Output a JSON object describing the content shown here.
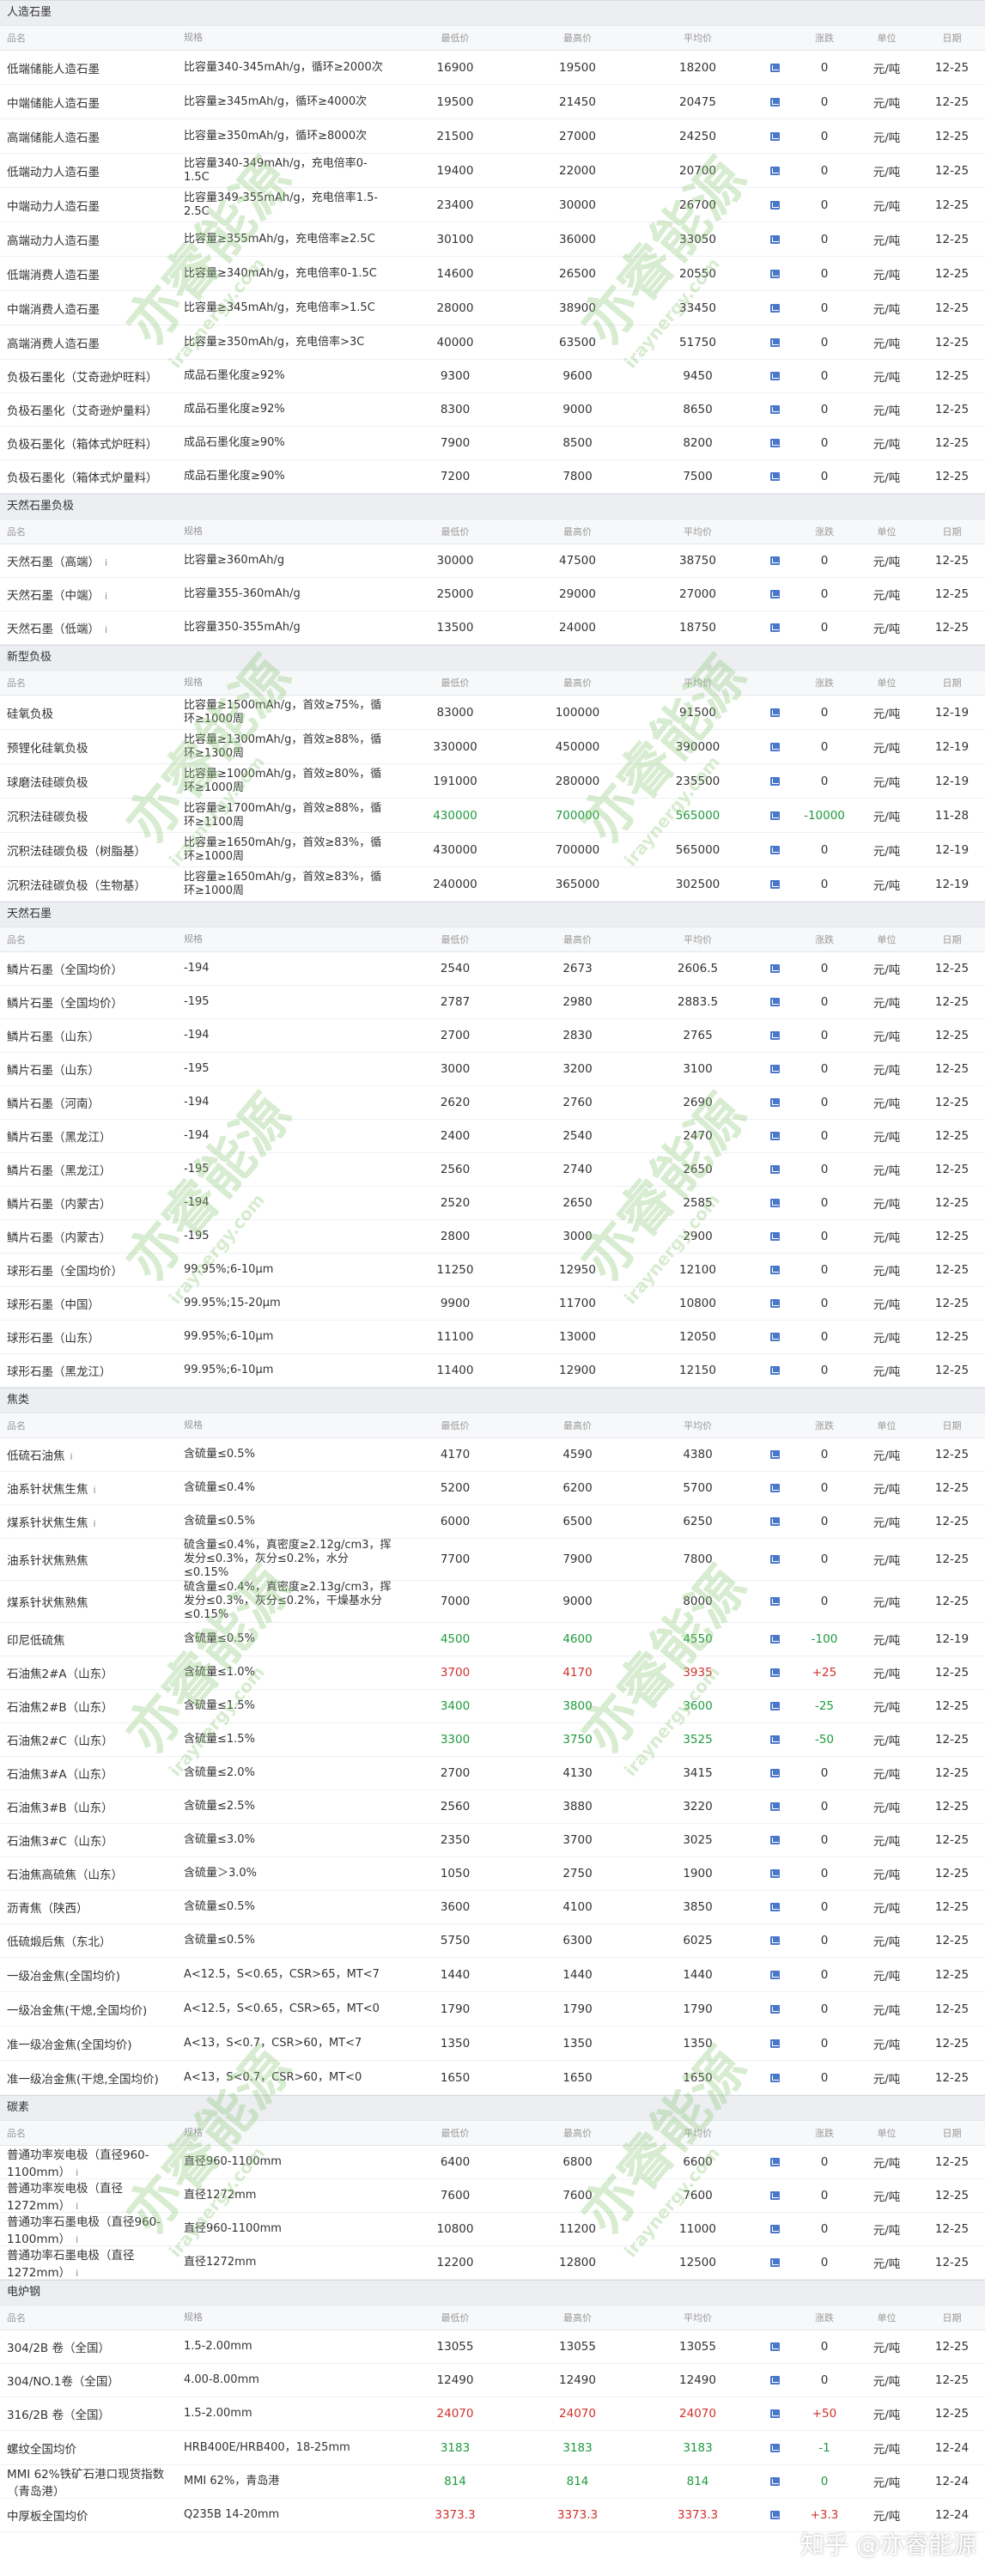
{
  "col_headers": {
    "name": "品名",
    "spec": "规格",
    "low": "最低价",
    "high": "最高价",
    "avg": "平均价",
    "chart": "",
    "change": "涨跌",
    "unit": "单位",
    "date": "日期"
  },
  "info_icon": "i",
  "colors": {
    "up": "#d0312d",
    "down": "#1e9a3e",
    "chart_icon": "#4a78c9"
  },
  "watermark": {
    "text": "亦睿能源",
    "sub": "iraynergy.com"
  },
  "zhihu_mark": "知乎 @亦睿能源",
  "sections": [
    {
      "title": "人造石墨",
      "rows": [
        {
          "name": "低端储能人造石墨",
          "spec": "比容量340-345mAh/g，循环≥2000次",
          "low": "16900",
          "high": "19500",
          "avg": "18200",
          "change": "0",
          "unit": "元/吨",
          "date": "12-25"
        },
        {
          "name": "中端储能人造石墨",
          "spec": "比容量≥345mAh/g，循环≥4000次",
          "low": "19500",
          "high": "21450",
          "avg": "20475",
          "change": "0",
          "unit": "元/吨",
          "date": "12-25"
        },
        {
          "name": "高端储能人造石墨",
          "spec": "比容量≥350mAh/g，循环≥8000次",
          "low": "21500",
          "high": "27000",
          "avg": "24250",
          "change": "0",
          "unit": "元/吨",
          "date": "12-25"
        },
        {
          "name": "低端动力人造石墨",
          "spec": "比容量340-349mAh/g，充电倍率0-1.5C",
          "low": "19400",
          "high": "22000",
          "avg": "20700",
          "change": "0",
          "unit": "元/吨",
          "date": "12-25"
        },
        {
          "name": "中端动力人造石墨",
          "spec": "比容量349-355mAh/g，充电倍率1.5-2.5C",
          "low": "23400",
          "high": "30000",
          "avg": "26700",
          "change": "0",
          "unit": "元/吨",
          "date": "12-25"
        },
        {
          "name": "高端动力人造石墨",
          "spec": "比容量≥355mAh/g，充电倍率≥2.5C",
          "low": "30100",
          "high": "36000",
          "avg": "33050",
          "change": "0",
          "unit": "元/吨",
          "date": "12-25"
        },
        {
          "name": "低端消费人造石墨",
          "spec": "比容量≥340mAh/g，充电倍率0-1.5C",
          "low": "14600",
          "high": "26500",
          "avg": "20550",
          "change": "0",
          "unit": "元/吨",
          "date": "12-25"
        },
        {
          "name": "中端消费人造石墨",
          "spec": "比容量≥345mAh/g，充电倍率>1.5C",
          "low": "28000",
          "high": "38900",
          "avg": "33450",
          "change": "0",
          "unit": "元/吨",
          "date": "12-25"
        },
        {
          "name": "高端消费人造石墨",
          "spec": "比容量≥350mAh/g，充电倍率>3C",
          "low": "40000",
          "high": "63500",
          "avg": "51750",
          "change": "0",
          "unit": "元/吨",
          "date": "12-25"
        },
        {
          "name": "负极石墨化（艾奇逊炉旺料）",
          "spec": "成品石墨化度≥92%",
          "low": "9300",
          "high": "9600",
          "avg": "9450",
          "change": "0",
          "unit": "元/吨",
          "date": "12-25"
        },
        {
          "name": "负极石墨化（艾奇逊炉量料）",
          "spec": "成品石墨化度≥92%",
          "low": "8300",
          "high": "9000",
          "avg": "8650",
          "change": "0",
          "unit": "元/吨",
          "date": "12-25"
        },
        {
          "name": "负极石墨化（箱体式炉旺料）",
          "spec": "成品石墨化度≥90%",
          "low": "7900",
          "high": "8500",
          "avg": "8200",
          "change": "0",
          "unit": "元/吨",
          "date": "12-25"
        },
        {
          "name": "负极石墨化（箱体式炉量料）",
          "spec": "成品石墨化度≥90%",
          "low": "7200",
          "high": "7800",
          "avg": "7500",
          "change": "0",
          "unit": "元/吨",
          "date": "12-25"
        }
      ]
    },
    {
      "title": "天然石墨负极",
      "rows": [
        {
          "name": "天然石墨（高端）",
          "info": true,
          "spec": "比容量≥360mAh/g",
          "low": "30000",
          "high": "47500",
          "avg": "38750",
          "change": "0",
          "unit": "元/吨",
          "date": "12-25"
        },
        {
          "name": "天然石墨（中端）",
          "info": true,
          "spec": "比容量355-360mAh/g",
          "low": "25000",
          "high": "29000",
          "avg": "27000",
          "change": "0",
          "unit": "元/吨",
          "date": "12-25"
        },
        {
          "name": "天然石墨（低端）",
          "info": true,
          "spec": "比容量350-355mAh/g",
          "low": "13500",
          "high": "24000",
          "avg": "18750",
          "change": "0",
          "unit": "元/吨",
          "date": "12-25"
        }
      ]
    },
    {
      "title": "新型负极",
      "rows": [
        {
          "name": "硅氧负极",
          "spec": "比容量≥1500mAh/g，首效≥75%，循环≥1000周",
          "low": "83000",
          "high": "100000",
          "avg": "91500",
          "change": "0",
          "unit": "元/吨",
          "date": "12-19"
        },
        {
          "name": "预锂化硅氧负极",
          "spec": "比容量≥1300mAh/g，首效≥88%，循环≥1300周",
          "low": "330000",
          "high": "450000",
          "avg": "390000",
          "change": "0",
          "unit": "元/吨",
          "date": "12-19"
        },
        {
          "name": "球磨法硅碳负极",
          "spec": "比容量≥1000mAh/g，首效≥80%，循环≥1000周",
          "low": "191000",
          "high": "280000",
          "avg": "235500",
          "change": "0",
          "unit": "元/吨",
          "date": "12-19"
        },
        {
          "name": "沉积法硅碳负极",
          "spec": "比容量≥1700mAh/g，首效≥88%，循环≥1100周",
          "low": "430000",
          "high": "700000",
          "avg": "565000",
          "change": "-10000",
          "unit": "元/吨",
          "date": "11-28",
          "trend": "down"
        },
        {
          "name": "沉积法硅碳负极（树脂基）",
          "spec": "比容量≥1650mAh/g，首效≥83%，循环≥1000周",
          "low": "430000",
          "high": "700000",
          "avg": "565000",
          "change": "0",
          "unit": "元/吨",
          "date": "12-19"
        },
        {
          "name": "沉积法硅碳负极（生物基）",
          "spec": "比容量≥1650mAh/g，首效≥83%，循环≥1000周",
          "low": "240000",
          "high": "365000",
          "avg": "302500",
          "change": "0",
          "unit": "元/吨",
          "date": "12-19"
        }
      ]
    },
    {
      "title": "天然石墨",
      "rows": [
        {
          "name": "鳞片石墨（全国均价）",
          "spec": "-194",
          "low": "2540",
          "high": "2673",
          "avg": "2606.5",
          "change": "0",
          "unit": "元/吨",
          "date": "12-25"
        },
        {
          "name": "鳞片石墨（全国均价）",
          "spec": "-195",
          "low": "2787",
          "high": "2980",
          "avg": "2883.5",
          "change": "0",
          "unit": "元/吨",
          "date": "12-25"
        },
        {
          "name": "鳞片石墨（山东）",
          "spec": "-194",
          "low": "2700",
          "high": "2830",
          "avg": "2765",
          "change": "0",
          "unit": "元/吨",
          "date": "12-25"
        },
        {
          "name": "鳞片石墨（山东）",
          "spec": "-195",
          "low": "3000",
          "high": "3200",
          "avg": "3100",
          "change": "0",
          "unit": "元/吨",
          "date": "12-25"
        },
        {
          "name": "鳞片石墨（河南）",
          "spec": "-194",
          "low": "2620",
          "high": "2760",
          "avg": "2690",
          "change": "0",
          "unit": "元/吨",
          "date": "12-25"
        },
        {
          "name": "鳞片石墨（黑龙江）",
          "spec": "-194",
          "low": "2400",
          "high": "2540",
          "avg": "2470",
          "change": "0",
          "unit": "元/吨",
          "date": "12-25"
        },
        {
          "name": "鳞片石墨（黑龙江）",
          "spec": "-195",
          "low": "2560",
          "high": "2740",
          "avg": "2650",
          "change": "0",
          "unit": "元/吨",
          "date": "12-25"
        },
        {
          "name": "鳞片石墨（内蒙古）",
          "spec": "-194",
          "low": "2520",
          "high": "2650",
          "avg": "2585",
          "change": "0",
          "unit": "元/吨",
          "date": "12-25"
        },
        {
          "name": "鳞片石墨（内蒙古）",
          "spec": "-195",
          "low": "2800",
          "high": "3000",
          "avg": "2900",
          "change": "0",
          "unit": "元/吨",
          "date": "12-25"
        },
        {
          "name": "球形石墨（全国均价）",
          "spec": "99.95%;6-10μm",
          "low": "11250",
          "high": "12950",
          "avg": "12100",
          "change": "0",
          "unit": "元/吨",
          "date": "12-25"
        },
        {
          "name": "球形石墨（中国）",
          "spec": "99.95%;15-20μm",
          "low": "9900",
          "high": "11700",
          "avg": "10800",
          "change": "0",
          "unit": "元/吨",
          "date": "12-25"
        },
        {
          "name": "球形石墨（山东）",
          "spec": "99.95%;6-10μm",
          "low": "11100",
          "high": "13000",
          "avg": "12050",
          "change": "0",
          "unit": "元/吨",
          "date": "12-25"
        },
        {
          "name": "球形石墨（黑龙江）",
          "spec": "99.95%;6-10μm",
          "low": "11400",
          "high": "12900",
          "avg": "12150",
          "change": "0",
          "unit": "元/吨",
          "date": "12-25"
        }
      ]
    },
    {
      "title": "焦类",
      "rows": [
        {
          "name": "低硫石油焦",
          "info": true,
          "spec": "含硫量≤0.5%",
          "low": "4170",
          "high": "4590",
          "avg": "4380",
          "change": "0",
          "unit": "元/吨",
          "date": "12-25"
        },
        {
          "name": "油系针状焦生焦",
          "info": true,
          "spec": "含硫量≤0.4%",
          "low": "5200",
          "high": "6200",
          "avg": "5700",
          "change": "0",
          "unit": "元/吨",
          "date": "12-25"
        },
        {
          "name": "煤系针状焦生焦",
          "info": true,
          "spec": "含硫量≤0.5%",
          "low": "6000",
          "high": "6500",
          "avg": "6250",
          "change": "0",
          "unit": "元/吨",
          "date": "12-25"
        },
        {
          "name": "油系针状焦熟焦",
          "spec": "硫含量≤0.4%，真密度≥2.12g/cm3，挥发分≤0.3%，灰分≤0.2%，水分≤0.15%",
          "low": "7700",
          "high": "7900",
          "avg": "7800",
          "change": "0",
          "unit": "元/吨",
          "date": "12-25"
        },
        {
          "name": "煤系针状焦熟焦",
          "spec": "硫含量≤0.4%，真密度≥2.13g/cm3，挥发分≤0.3%，灰分≤0.2%，干燥基水分≤0.15%",
          "low": "7000",
          "high": "9000",
          "avg": "8000",
          "change": "0",
          "unit": "元/吨",
          "date": "12-25"
        },
        {
          "name": "印尼低硫焦",
          "spec": "含硫量≤0.5%",
          "low": "4500",
          "high": "4600",
          "avg": "4550",
          "change": "-100",
          "unit": "元/吨",
          "date": "12-19",
          "trend": "down"
        },
        {
          "name": "石油焦2#A（山东）",
          "spec": "含硫量≤1.0%",
          "low": "3700",
          "high": "4170",
          "avg": "3935",
          "change": "+25",
          "unit": "元/吨",
          "date": "12-25",
          "trend": "up"
        },
        {
          "name": "石油焦2#B（山东）",
          "spec": "含硫量≤1.5%",
          "low": "3400",
          "high": "3800",
          "avg": "3600",
          "change": "-25",
          "unit": "元/吨",
          "date": "12-25",
          "trend": "down"
        },
        {
          "name": "石油焦2#C（山东）",
          "spec": "含硫量≤1.5%",
          "low": "3300",
          "high": "3750",
          "avg": "3525",
          "change": "-50",
          "unit": "元/吨",
          "date": "12-25",
          "trend": "down"
        },
        {
          "name": "石油焦3#A（山东）",
          "spec": "含硫量≤2.0%",
          "low": "2700",
          "high": "4130",
          "avg": "3415",
          "change": "0",
          "unit": "元/吨",
          "date": "12-25"
        },
        {
          "name": "石油焦3#B（山东）",
          "spec": "含硫量≤2.5%",
          "low": "2560",
          "high": "3880",
          "avg": "3220",
          "change": "0",
          "unit": "元/吨",
          "date": "12-25"
        },
        {
          "name": "石油焦3#C（山东）",
          "spec": "含硫量≤3.0%",
          "low": "2350",
          "high": "3700",
          "avg": "3025",
          "change": "0",
          "unit": "元/吨",
          "date": "12-25"
        },
        {
          "name": "石油焦高硫焦（山东）",
          "spec": "含硫量＞3.0%",
          "low": "1050",
          "high": "2750",
          "avg": "1900",
          "change": "0",
          "unit": "元/吨",
          "date": "12-25"
        },
        {
          "name": "沥青焦（陕西）",
          "spec": "含硫量≤0.5%",
          "low": "3600",
          "high": "4100",
          "avg": "3850",
          "change": "0",
          "unit": "元/吨",
          "date": "12-25"
        },
        {
          "name": "低硫煅后焦（东北）",
          "spec": "含硫量≤0.5%",
          "low": "5750",
          "high": "6300",
          "avg": "6025",
          "change": "0",
          "unit": "元/吨",
          "date": "12-25"
        },
        {
          "name": "一级冶金焦(全国均价)",
          "spec": "A<12.5，S<0.65，CSR>65，MT<7",
          "low": "1440",
          "high": "1440",
          "avg": "1440",
          "change": "0",
          "unit": "元/吨",
          "date": "12-25"
        },
        {
          "name": "一级冶金焦(干熄,全国均价)",
          "spec": "A<12.5，S<0.65，CSR>65，MT<0",
          "low": "1790",
          "high": "1790",
          "avg": "1790",
          "change": "0",
          "unit": "元/吨",
          "date": "12-25"
        },
        {
          "name": "准一级冶金焦(全国均价)",
          "spec": "A<13，S<0.7，CSR>60，MT<7",
          "low": "1350",
          "high": "1350",
          "avg": "1350",
          "change": "0",
          "unit": "元/吨",
          "date": "12-25"
        },
        {
          "name": "准一级冶金焦(干熄,全国均价)",
          "spec": "A<13，S<0.7，CSR>60，MT<0",
          "low": "1650",
          "high": "1650",
          "avg": "1650",
          "change": "0",
          "unit": "元/吨",
          "date": "12-25"
        }
      ]
    },
    {
      "title": "碳素",
      "rows": [
        {
          "name": "普通功率炭电极（直径960-1100mm）",
          "info": true,
          "spec": "直径960-1100mm",
          "low": "6400",
          "high": "6800",
          "avg": "6600",
          "change": "0",
          "unit": "元/吨",
          "date": "12-25"
        },
        {
          "name": "普通功率炭电极（直径1272mm）",
          "info": true,
          "spec": "直径1272mm",
          "low": "7600",
          "high": "7600",
          "avg": "7600",
          "change": "0",
          "unit": "元/吨",
          "date": "12-25"
        },
        {
          "name": "普通功率石墨电极（直径960-1100mm）",
          "info": true,
          "spec": "直径960-1100mm",
          "low": "10800",
          "high": "11200",
          "avg": "11000",
          "change": "0",
          "unit": "元/吨",
          "date": "12-25"
        },
        {
          "name": "普通功率石墨电极（直径1272mm）",
          "info": true,
          "spec": "直径1272mm",
          "low": "12200",
          "high": "12800",
          "avg": "12500",
          "change": "0",
          "unit": "元/吨",
          "date": "12-25"
        }
      ]
    },
    {
      "title": "电炉钢",
      "rows": [
        {
          "name": "304/2B 卷（全国）",
          "spec": "1.5-2.00mm",
          "low": "13055",
          "high": "13055",
          "avg": "13055",
          "change": "0",
          "unit": "元/吨",
          "date": "12-25"
        },
        {
          "name": "304/NO.1卷（全国）",
          "spec": "4.00-8.00mm",
          "low": "12490",
          "high": "12490",
          "avg": "12490",
          "change": "0",
          "unit": "元/吨",
          "date": "12-25"
        },
        {
          "name": "316/2B 卷（全国）",
          "spec": "1.5-2.00mm",
          "low": "24070",
          "high": "24070",
          "avg": "24070",
          "change": "+50",
          "unit": "元/吨",
          "date": "12-25",
          "trend": "up"
        },
        {
          "name": "螺纹全国均价",
          "spec": "HRB400E/HRB400，18-25mm",
          "low": "3183",
          "high": "3183",
          "avg": "3183",
          "change": "-1",
          "unit": "元/吨",
          "date": "12-24",
          "trend": "down"
        },
        {
          "name": "MMI 62%铁矿石港口现货指数（青岛港）",
          "spec": "MMI 62%，青岛港",
          "low": "814",
          "high": "814",
          "avg": "814",
          "change": "0",
          "unit": "元/吨",
          "date": "12-24",
          "trend": "down"
        },
        {
          "name": "中厚板全国均价",
          "spec": "Q235B 14-20mm",
          "low": "3373.3",
          "high": "3373.3",
          "avg": "3373.3",
          "change": "+3.3",
          "unit": "元/吨",
          "date": "12-24",
          "trend": "up"
        }
      ]
    }
  ]
}
